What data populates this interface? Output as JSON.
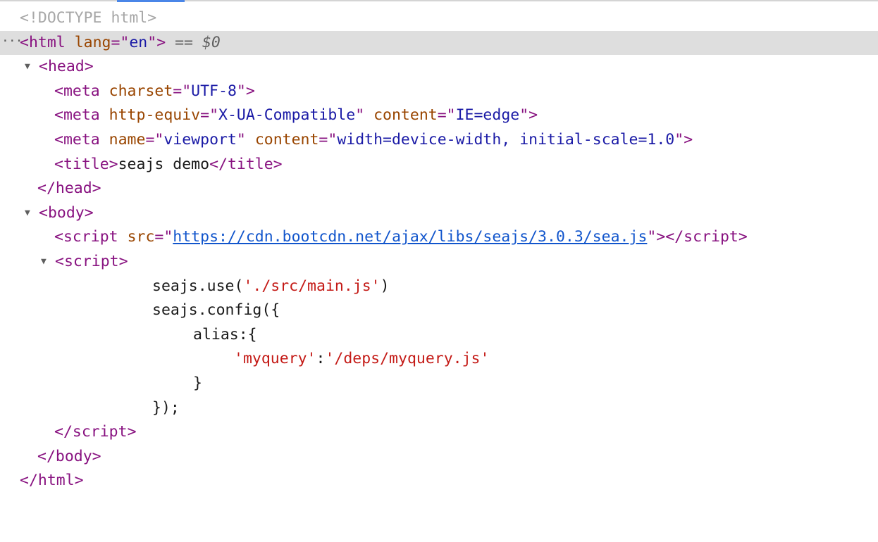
{
  "doctype": "<!DOCTYPE html>",
  "html": {
    "tag": "html",
    "attr_name": "lang",
    "attr_value": "en",
    "eq": "==",
    "ref": "$0"
  },
  "head": {
    "tag": "head"
  },
  "meta1": {
    "attr_name": "charset",
    "attr_value": "UTF-8"
  },
  "meta2": {
    "attr1_name": "http-equiv",
    "attr1_value": "X-UA-Compatible",
    "attr2_name": "content",
    "attr2_value": "IE=edge"
  },
  "meta3": {
    "attr1_name": "name",
    "attr1_value": "viewport",
    "attr2_name": "content",
    "attr2_value": "width=device-width, initial-scale=1.0"
  },
  "title": {
    "text": "seajs demo"
  },
  "body": {
    "tag": "body"
  },
  "script1": {
    "attr_name": "src",
    "url": "https://cdn.bootcdn.net/ajax/libs/seajs/3.0.3/sea.js"
  },
  "script2": {
    "tag": "script"
  },
  "code": {
    "l1_a": "seajs.use(",
    "l1_b": "'./src/main.js'",
    "l1_c": ")",
    "l2": "seajs.config({",
    "l3": "alias:{",
    "l4_a": "'myquery'",
    "l4_b": ":",
    "l4_c": "'/deps/myquery.js'",
    "l5": "}",
    "l6": "});"
  },
  "icons": {
    "expand": "triangle-down-icon",
    "more": "ellipsis-icon"
  }
}
